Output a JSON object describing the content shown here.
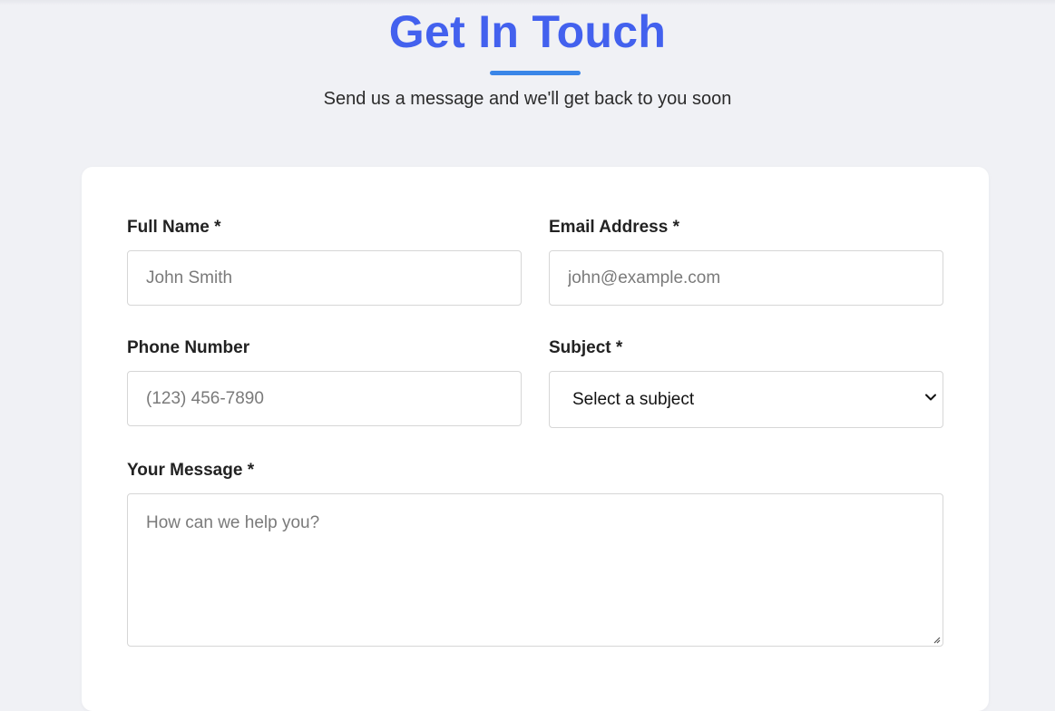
{
  "header": {
    "title": "Get In Touch",
    "subtitle": "Send us a message and we'll get back to you soon",
    "accent_color": "#4361ee",
    "underline_color": "#3a86e8"
  },
  "form": {
    "full_name": {
      "label": "Full Name *",
      "placeholder": "John Smith",
      "value": ""
    },
    "email": {
      "label": "Email Address *",
      "placeholder": "john@example.com",
      "value": ""
    },
    "phone": {
      "label": "Phone Number",
      "placeholder": "(123) 456-7890",
      "value": ""
    },
    "subject": {
      "label": "Subject *",
      "selected": "Select a subject",
      "icon": "chevron-down-icon"
    },
    "message": {
      "label": "Your Message *",
      "placeholder": "How can we help you?",
      "value": ""
    }
  }
}
